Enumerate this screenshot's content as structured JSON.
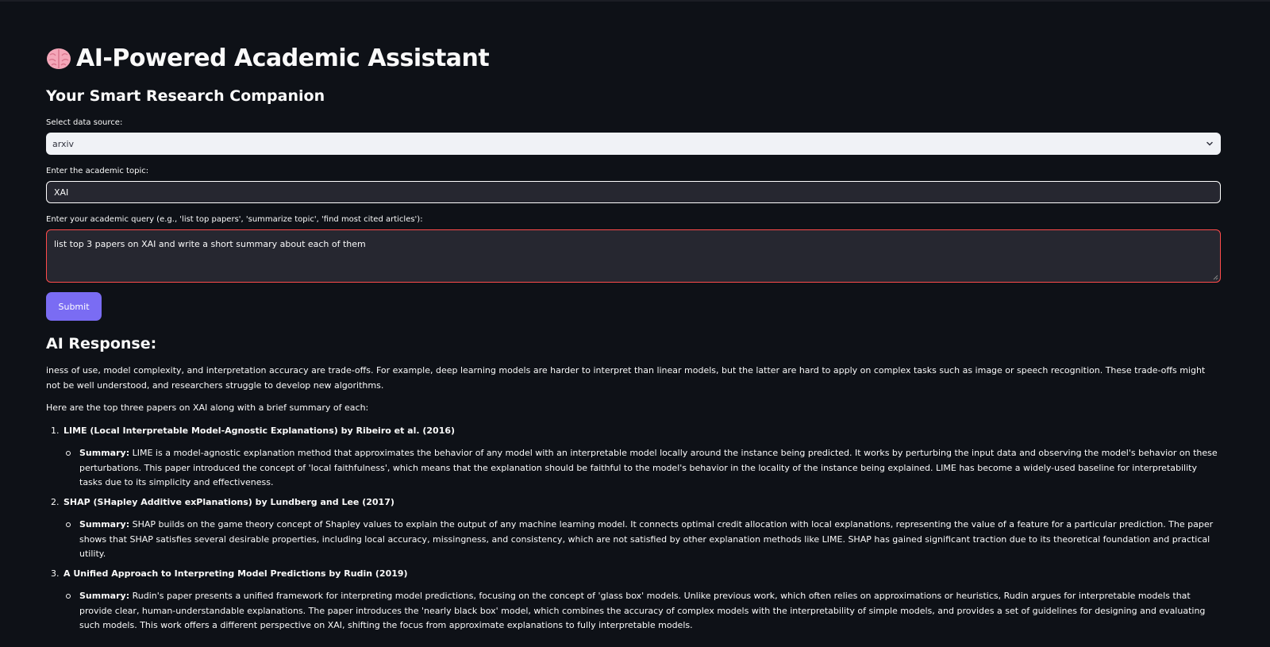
{
  "app": {
    "title": "AI-Powered Academic Assistant",
    "subtitle": "Your Smart Research Companion"
  },
  "data_source": {
    "label": "Select data source:",
    "selected": "arxiv"
  },
  "topic": {
    "label": "Enter the academic topic:",
    "value": "XAI"
  },
  "query": {
    "label": "Enter your academic query (e.g., 'list top papers', 'summarize topic', 'find most cited articles'):",
    "value": "list top 3 papers on XAI and write a short summary about each of them"
  },
  "submit_label": "Submit",
  "response": {
    "heading": "AI Response:",
    "intro": "iness of use, model complexity, and interpretation accuracy are trade-offs. For example, deep learning models are harder to interpret than linear models, but the latter are hard to apply on complex tasks such as image or speech recognition. These trade-offs might not be well understood, and researchers struggle to develop new algorithms.",
    "lead": "Here are the top three papers on XAI along with a brief summary of each:",
    "summary_label": "Summary:",
    "papers": [
      {
        "title": "LIME (Local Interpretable Model-Agnostic Explanations) by Ribeiro et al. (2016)",
        "summary": "LIME is a model-agnostic explanation method that approximates the behavior of any model with an interpretable model locally around the instance being predicted. It works by perturbing the input data and observing the model's behavior on these perturbations. This paper introduced the concept of 'local faithfulness', which means that the explanation should be faithful to the model's behavior in the locality of the instance being explained. LIME has become a widely-used baseline for interpretability tasks due to its simplicity and effectiveness."
      },
      {
        "title": "SHAP (SHapley Additive exPlanations) by Lundberg and Lee (2017)",
        "summary": "SHAP builds on the game theory concept of Shapley values to explain the output of any machine learning model. It connects optimal credit allocation with local explanations, representing the value of a feature for a particular prediction. The paper shows that SHAP satisfies several desirable properties, including local accuracy, missingness, and consistency, which are not satisfied by other explanation methods like LIME. SHAP has gained significant traction due to its theoretical foundation and practical utility."
      },
      {
        "title": "A Unified Approach to Interpreting Model Predictions by Rudin (2019)",
        "summary": "Rudin's paper presents a unified framework for interpreting model predictions, focusing on the concept of 'glass box' models. Unlike previous work, which often relies on approximations or heuristics, Rudin argues for interpretable models that provide clear, human-understandable explanations. The paper introduces the 'nearly black box' model, which combines the accuracy of complex models with the interpretability of simple models, and provides a set of guidelines for designing and evaluating such models. This work offers a different perspective on XAI, shifting the focus from approximate explanations to fully interpretable models."
      }
    ]
  },
  "icons": {
    "title": "brain-icon",
    "select": "chevron-down-icon",
    "textarea": "resize-handle-icon"
  }
}
